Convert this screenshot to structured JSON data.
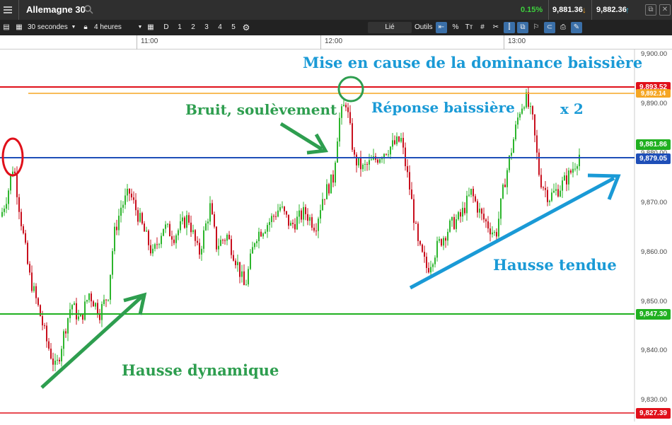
{
  "header": {
    "title": "Allemagne 30",
    "change_pct": "0.15%",
    "bid": "9,881.36",
    "ask": "9,882.36"
  },
  "toolbar": {
    "interval": "30 secondes",
    "range": "4 heures",
    "drawing_modes": [
      "D",
      "1",
      "2",
      "3",
      "4",
      "5"
    ],
    "linked_label": "Lié",
    "tools_label": "Outils",
    "percent_label": "%",
    "text_label": "Tт"
  },
  "time_axis": {
    "ticks": [
      "11:00",
      "12:00",
      "13:00"
    ]
  },
  "price_axis": {
    "ticks": [
      "9,900.00",
      "9,890.00",
      "9,880.00",
      "9,870.00",
      "9,860.00",
      "9,850.00",
      "9,840.00",
      "9,830.00"
    ]
  },
  "levels": {
    "red_top": "9,893.52",
    "orange": "9,892.14",
    "last": "9,881.86",
    "blue": "9,879.05",
    "green": "9,847.30",
    "red_bottom": "9,827.39"
  },
  "annotations": {
    "top": "Mise en cause de la dominance baissière",
    "noise": "Bruit, soulèvement",
    "bear_reply": "Réponse baissière",
    "x2": "x 2",
    "tense_rise": "Hausse tendue",
    "dynamic_rise": "Hausse dynamique"
  },
  "colors": {
    "up": "#2db52d",
    "down": "#c8101e",
    "green_text": "#2e9e4f",
    "blue_text": "#1a9ad6",
    "red_line": "#e0101a",
    "orange_line": "#f5a623",
    "blue_line": "#1f4fb8",
    "green_line": "#20b020"
  },
  "chart_data": {
    "type": "candlestick",
    "x_label": "time",
    "y_range": [
      9826,
      9902
    ],
    "close_path": [
      [
        0,
        9868
      ],
      [
        10,
        9873
      ],
      [
        18,
        9879
      ],
      [
        28,
        9868
      ],
      [
        40,
        9856
      ],
      [
        55,
        9848
      ],
      [
        65,
        9842
      ],
      [
        78,
        9836
      ],
      [
        90,
        9844
      ],
      [
        100,
        9850
      ],
      [
        112,
        9846
      ],
      [
        125,
        9852
      ],
      [
        140,
        9848
      ],
      [
        152,
        9852
      ],
      [
        160,
        9864
      ],
      [
        170,
        9870
      ],
      [
        182,
        9873
      ],
      [
        195,
        9868
      ],
      [
        215,
        9860
      ],
      [
        230,
        9866
      ],
      [
        245,
        9864
      ],
      [
        265,
        9868
      ],
      [
        280,
        9860
      ],
      [
        296,
        9870
      ],
      [
        305,
        9862
      ],
      [
        320,
        9864
      ],
      [
        335,
        9858
      ],
      [
        345,
        9853
      ],
      [
        360,
        9864
      ],
      [
        380,
        9867
      ],
      [
        395,
        9870
      ],
      [
        410,
        9866
      ],
      [
        430,
        9869
      ],
      [
        445,
        9866
      ],
      [
        455,
        9872
      ],
      [
        470,
        9876
      ],
      [
        478,
        9888
      ],
      [
        488,
        9892
      ],
      [
        500,
        9880
      ],
      [
        512,
        9878
      ],
      [
        530,
        9880
      ],
      [
        545,
        9882
      ],
      [
        566,
        9884
      ],
      [
        578,
        9874
      ],
      [
        590,
        9862
      ],
      [
        603,
        9857
      ],
      [
        618,
        9862
      ],
      [
        635,
        9866
      ],
      [
        650,
        9868
      ],
      [
        665,
        9873
      ],
      [
        680,
        9868
      ],
      [
        700,
        9864
      ],
      [
        712,
        9875
      ],
      [
        722,
        9882
      ],
      [
        733,
        9890
      ],
      [
        742,
        9893
      ],
      [
        752,
        9888
      ],
      [
        762,
        9876
      ],
      [
        775,
        9872
      ],
      [
        790,
        9874
      ],
      [
        805,
        9877
      ],
      [
        818,
        9881
      ]
    ]
  }
}
